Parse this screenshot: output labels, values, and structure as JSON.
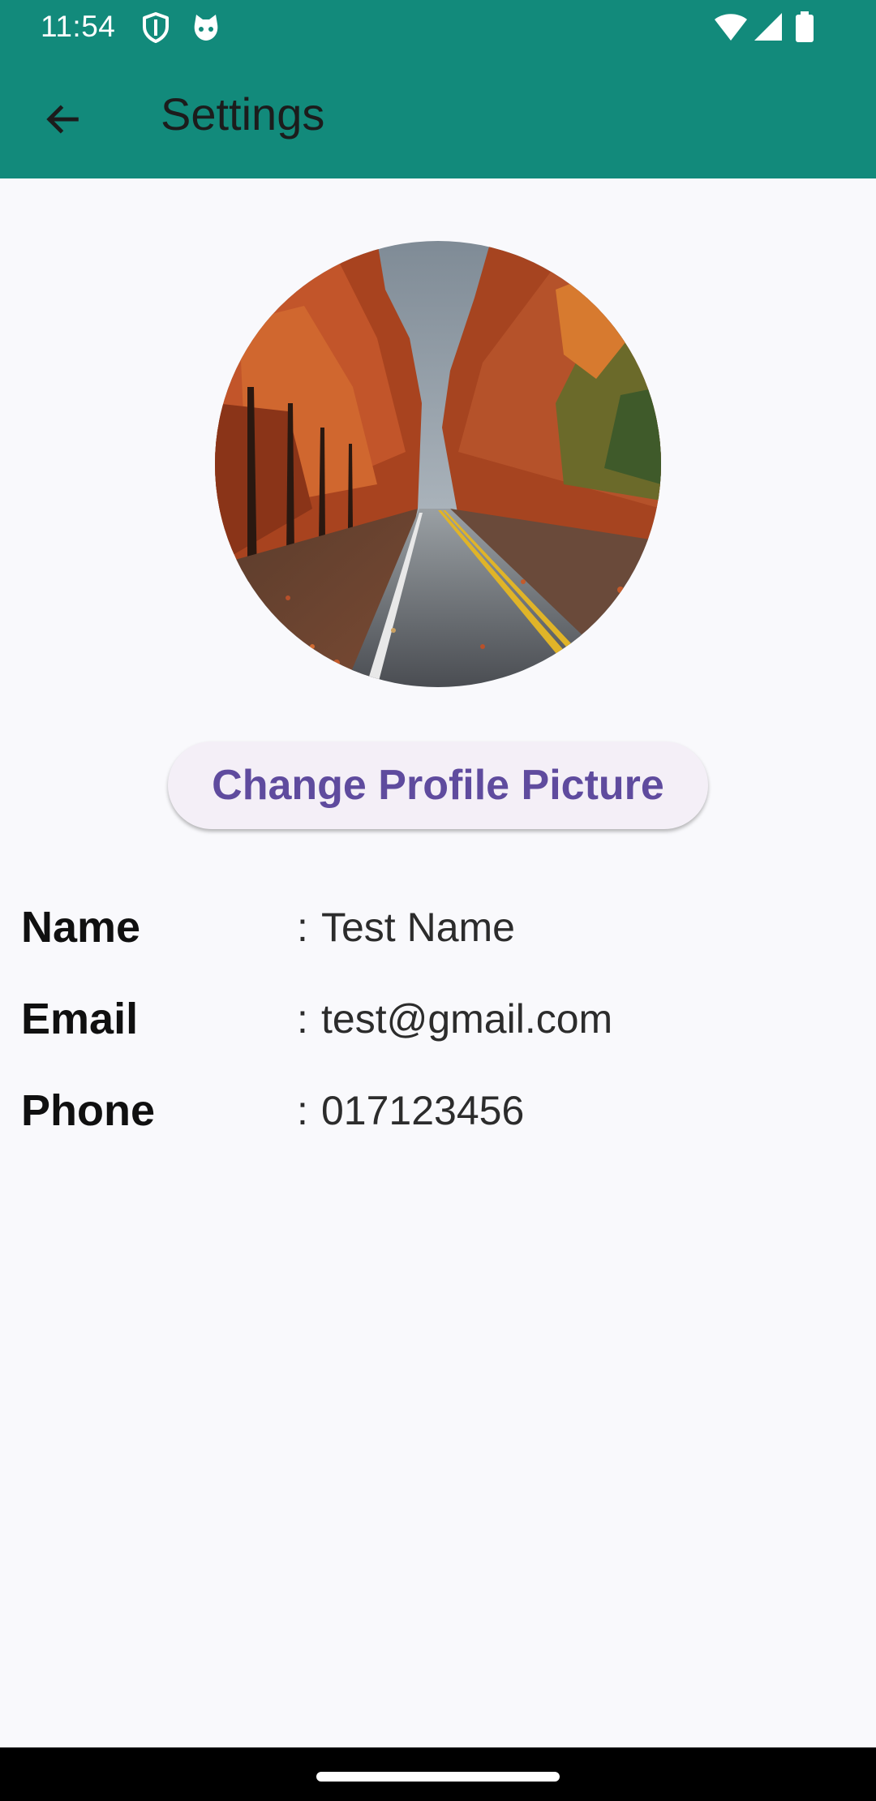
{
  "status_bar": {
    "time": "11:54",
    "icons": [
      "shield-icon",
      "cat-face-icon",
      "wifi-icon",
      "cellular-icon",
      "battery-icon"
    ]
  },
  "app_bar": {
    "title": "Settings",
    "back_icon": "arrow-left-icon"
  },
  "profile": {
    "avatar_description": "autumn-road-photo",
    "change_button_label": "Change Profile Picture",
    "fields": [
      {
        "label": "Name",
        "separator": ":",
        "value": "Test Name"
      },
      {
        "label": "Email",
        "separator": ":",
        "value": "test@gmail.com"
      },
      {
        "label": "Phone",
        "separator": ":",
        "value": "017123456"
      }
    ]
  },
  "colors": {
    "primary": "#128a7b",
    "background": "#f9f9fc",
    "button_bg": "#f4eff7",
    "button_text": "#5f4b9e"
  }
}
